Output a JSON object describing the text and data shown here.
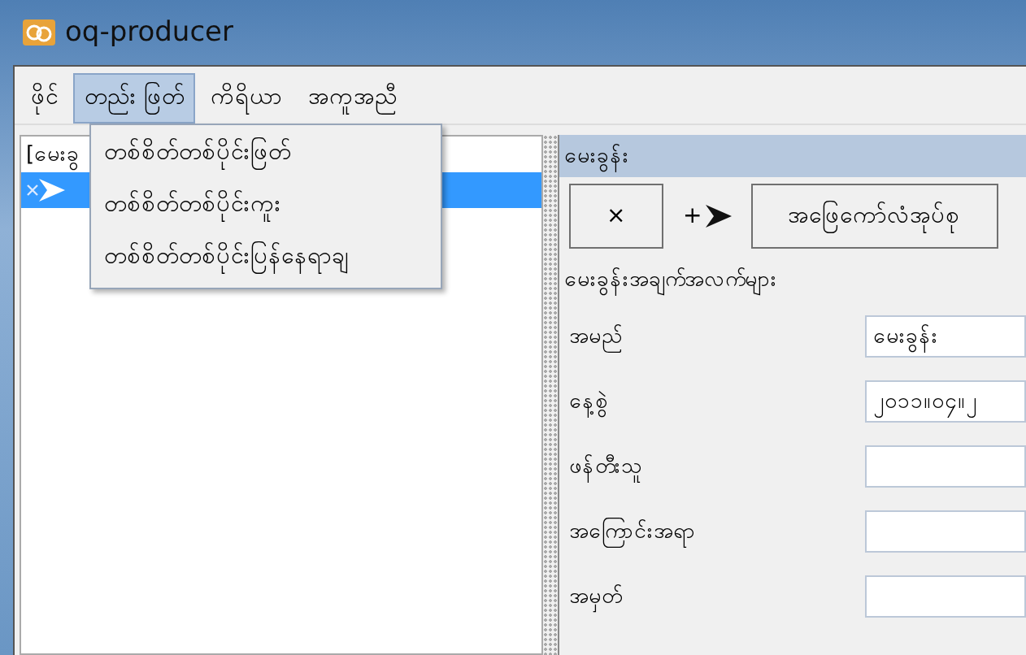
{
  "window": {
    "title": "oq-producer"
  },
  "menu": [
    {
      "label": "ဖိုင်",
      "selected": false
    },
    {
      "label": "တည်း ဖြတ်",
      "selected": true
    },
    {
      "label": "ကိရိယာ",
      "selected": false
    },
    {
      "label": "အကူအညီ",
      "selected": false
    }
  ],
  "dropdown": [
    "တစ်စိတ်တစ်ပိုင်းဖြတ်",
    "တစ်စိတ်တစ်ပိုင်းကူး",
    "တစ်စိတ်တစ်ပိုင်းပြန်နေရာချ"
  ],
  "tree": [
    {
      "kind": "text",
      "label": "[မေးခွ",
      "selected": false
    },
    {
      "kind": "icons",
      "selected": true
    }
  ],
  "panel": {
    "title": "မေးခွန်း",
    "buttons": [
      {
        "kind": "framed",
        "label": "×"
      },
      {
        "kind": "flat",
        "label": "+"
      },
      {
        "kind": "framed",
        "label": "အဖြေကော်လံအုပ်စု"
      }
    ],
    "section": "မေးခွန်းအချက်အလက်များ",
    "fields": [
      {
        "label": "အမည်",
        "value": "မေးခွန်း"
      },
      {
        "label": "နေ့စွဲ",
        "value": "၂၀၁၁။၀၄။၂"
      },
      {
        "label": "ဖန်တီးသူ"
      },
      {
        "label": "အကြောင်းအရာ"
      },
      {
        "label": "အမှတ်"
      }
    ]
  }
}
